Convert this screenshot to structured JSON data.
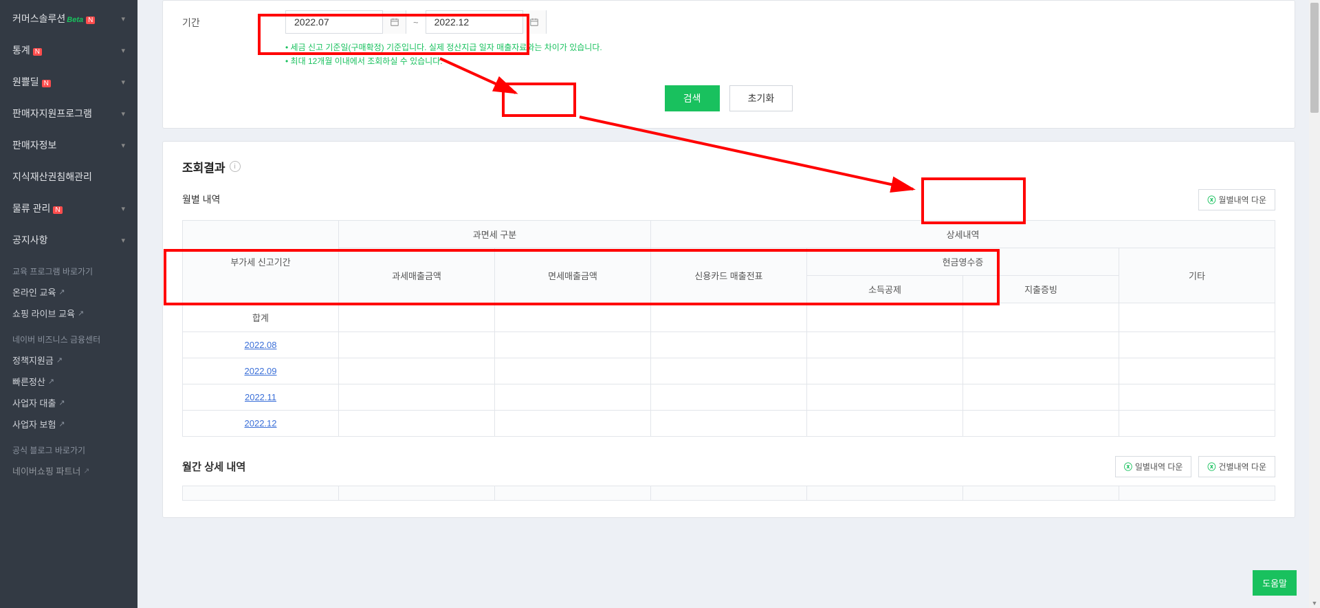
{
  "sidebar": {
    "items": [
      {
        "label": "커머스솔루션",
        "beta": "Beta",
        "n": true,
        "chev": true
      },
      {
        "label": "통계",
        "n": true,
        "chev": true
      },
      {
        "label": "원쁠딜",
        "n": true,
        "chev": true
      },
      {
        "label": "판매자지원프로그램",
        "chev": true
      },
      {
        "label": "판매자정보",
        "chev": true
      },
      {
        "label": "지식재산권침해관리"
      },
      {
        "label": "물류 관리",
        "n": true,
        "chev": true
      },
      {
        "label": "공지사항",
        "chev": true
      }
    ],
    "edu_title": "교육 프로그램 바로가기",
    "edu_links": [
      "온라인 교육",
      "쇼핑 라이브 교육"
    ],
    "fin_title": "네이버 비즈니스 금융센터",
    "fin_links": [
      "정책지원금",
      "빠른정산",
      "사업자 대출",
      "사업자 보험"
    ],
    "blog_title": "공식 블로그 바로가기",
    "blog_link": "네이버쇼핑 파트너"
  },
  "period": {
    "label": "기간",
    "from": "2022.07",
    "to": "2022.12",
    "tilde": "~",
    "note1": "세금 신고 기준일(구매확정) 기준입니다. 실제 정산지급 일자 매출자료와는 차이가 있습니다.",
    "note2": "최대 12개월 이내에서 조회하실 수 있습니다."
  },
  "buttons": {
    "search": "검색",
    "reset": "초기화"
  },
  "result": {
    "title": "조회결과",
    "monthly_title": "월별 내역",
    "download_monthly": "월별내역 다운",
    "detail_title": "월간 상세 내역",
    "download_daily": "일별내역 다운",
    "download_case": "건별내역 다운"
  },
  "table": {
    "group_tax_type": "과면세 구분",
    "group_detail": "상세내역",
    "col_period": "부가세 신고기간",
    "col_taxable": "과세매출금액",
    "col_exempt": "면세매출금액",
    "col_card": "신용카드 매출전표",
    "col_cashreceipt": "현금영수증",
    "col_income": "소득공제",
    "col_expense": "지출증빙",
    "col_other": "기타",
    "row_total": "합계",
    "rows": [
      "2022.08",
      "2022.09",
      "2022.11",
      "2022.12"
    ]
  },
  "help": "도움말"
}
